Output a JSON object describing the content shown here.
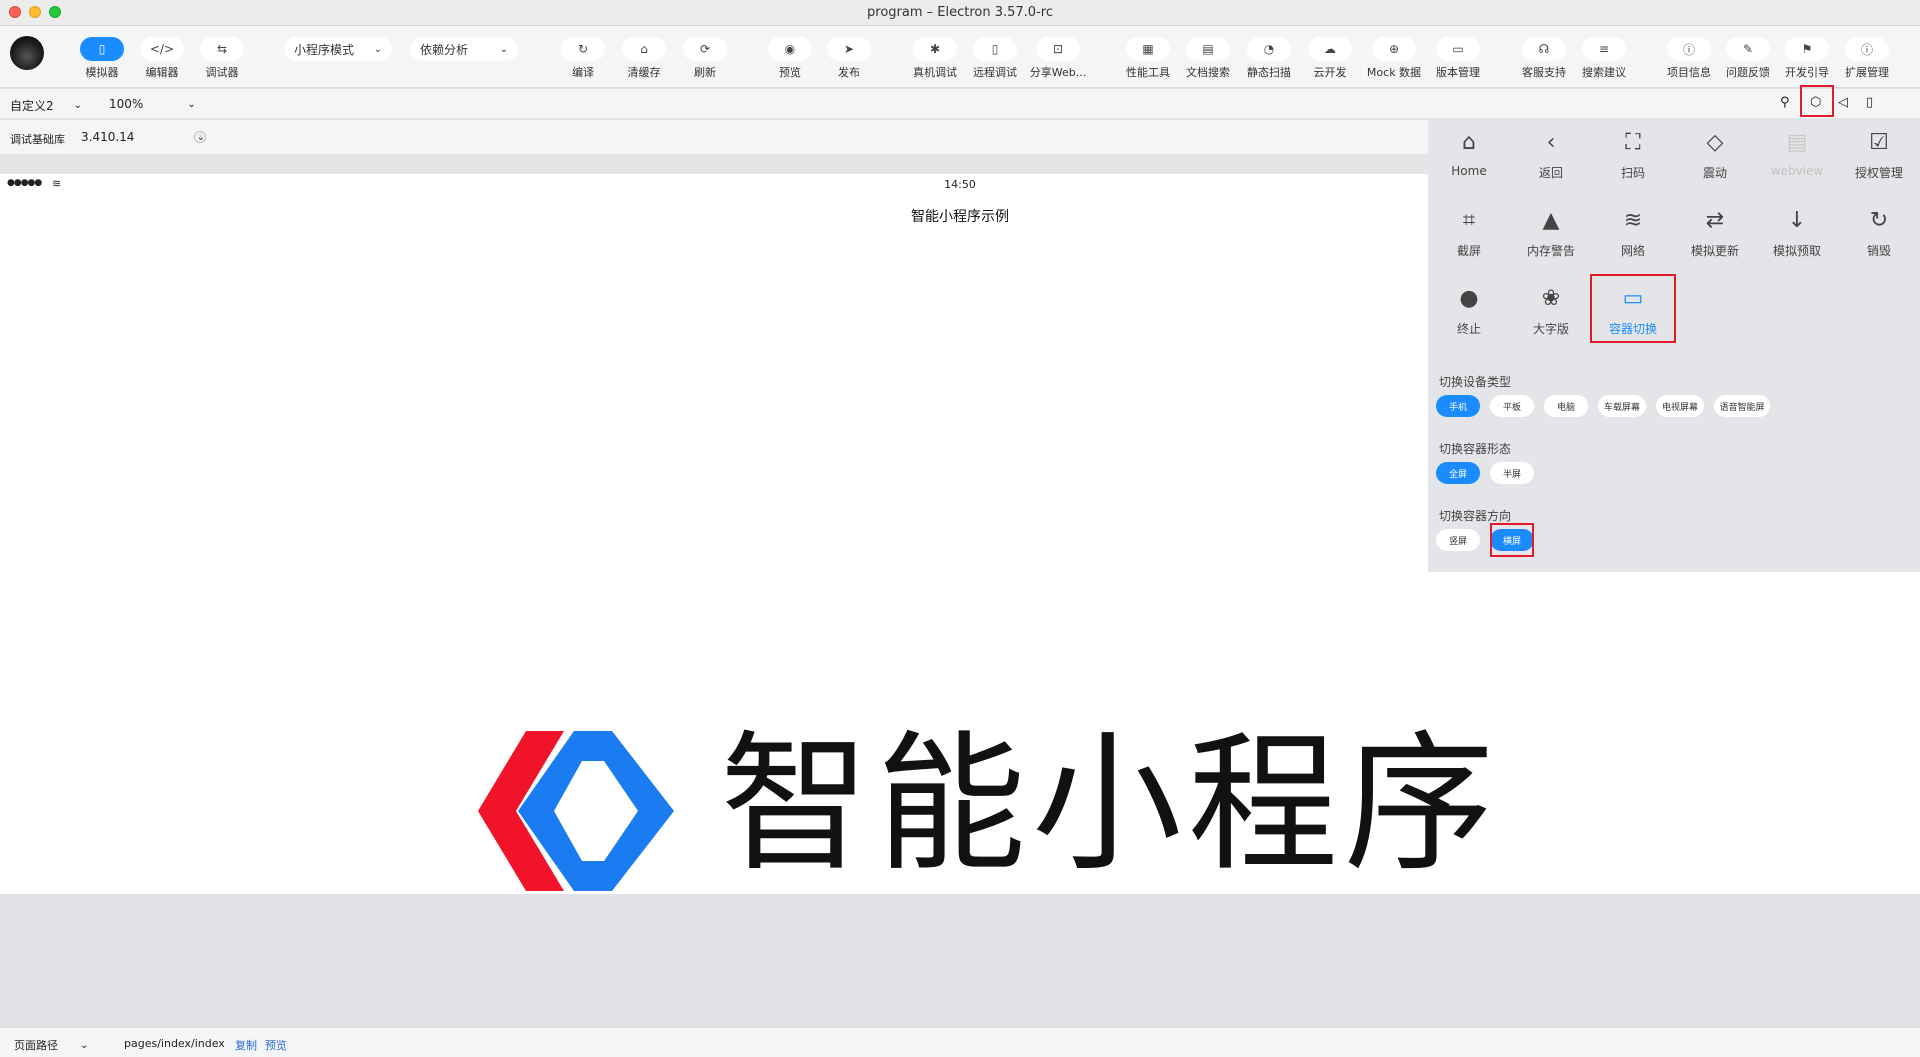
{
  "window": {
    "title": "program – Electron 3.57.0-rc"
  },
  "toolbar": {
    "left_buttons": [
      {
        "icon": "phone-icon",
        "glyph": "▯",
        "label": "模拟器",
        "active": true
      },
      {
        "icon": "code-icon",
        "glyph": "</>",
        "label": "编辑器",
        "active": false
      },
      {
        "icon": "sliders-icon",
        "glyph": "⇆",
        "label": "调试器",
        "active": false
      }
    ],
    "mode_select": "小程序模式",
    "analysis_select": "依赖分析",
    "center_buttons": [
      {
        "icon": "refresh-icon",
        "glyph": "↻",
        "label": "编译"
      },
      {
        "icon": "broom-icon",
        "glyph": "⌂",
        "label": "清缓存"
      },
      {
        "icon": "reload-icon",
        "glyph": "⟳",
        "label": "刷新"
      },
      {
        "icon": "eye-icon",
        "glyph": "◉",
        "label": "预览"
      },
      {
        "icon": "send-icon",
        "glyph": "➤",
        "label": "发布"
      },
      {
        "icon": "bug-icon",
        "glyph": "✱",
        "label": "真机调试"
      },
      {
        "icon": "mobile-icon",
        "glyph": "▯",
        "label": "远程调试"
      },
      {
        "icon": "share-icon",
        "glyph": "⊡",
        "label": "分享Web..."
      },
      {
        "icon": "gauge-icon",
        "glyph": "▦",
        "label": "性能工具"
      },
      {
        "icon": "doc-search-icon",
        "glyph": "▤",
        "label": "文档搜索"
      },
      {
        "icon": "scan-icon",
        "glyph": "◔",
        "label": "静态扫描"
      },
      {
        "icon": "cloud-icon",
        "glyph": "☁",
        "label": "云开发"
      },
      {
        "icon": "globe-icon",
        "glyph": "⊕",
        "label": "Mock 数据"
      },
      {
        "icon": "monitor-icon",
        "glyph": "▭",
        "label": "版本管理"
      }
    ],
    "right_buttons": [
      {
        "icon": "headset-icon",
        "glyph": "☊",
        "label": "客服支持"
      },
      {
        "icon": "search-suggest-icon",
        "glyph": "≡",
        "label": "搜索建议"
      },
      {
        "icon": "info-icon",
        "glyph": "ⓘ",
        "label": "项目信息"
      },
      {
        "icon": "pen-icon",
        "glyph": "✎",
        "label": "问题反馈"
      },
      {
        "icon": "flag-icon",
        "glyph": "⚑",
        "label": "开发引导"
      },
      {
        "icon": "extension-icon",
        "glyph": "ⓘ",
        "label": "扩展管理"
      }
    ]
  },
  "device_bar": {
    "device": "自定义2",
    "zoom": "100%",
    "icons": [
      "user-icon",
      "cube-icon",
      "speaker-icon",
      "copy-icon"
    ]
  },
  "debug_bar": {
    "label": "调试基础库",
    "version": "3.410.14"
  },
  "phone": {
    "signal": "●●●●●",
    "time": "14:50",
    "nav_title": "智能小程序示例",
    "logo_text": "智能小程序"
  },
  "panel": {
    "items": [
      {
        "icon": "home-icon",
        "glyph": "⌂",
        "label": "Home",
        "state": "normal"
      },
      {
        "icon": "back-icon",
        "glyph": "‹",
        "label": "返回",
        "state": "normal"
      },
      {
        "icon": "scan-frame-icon",
        "glyph": "⛶",
        "label": "扫码",
        "state": "normal"
      },
      {
        "icon": "vibrate-icon",
        "glyph": "◇",
        "label": "震动",
        "state": "normal"
      },
      {
        "icon": "webview-icon",
        "glyph": "▤",
        "label": "webview",
        "state": "disabled"
      },
      {
        "icon": "auth-icon",
        "glyph": "☑",
        "label": "授权管理",
        "state": "normal"
      },
      {
        "icon": "crop-icon",
        "glyph": "⌗",
        "label": "截屏",
        "state": "normal"
      },
      {
        "icon": "warning-icon",
        "glyph": "▲",
        "label": "内存警告",
        "state": "normal"
      },
      {
        "icon": "wifi-icon",
        "glyph": "≋",
        "label": "网络",
        "state": "normal"
      },
      {
        "icon": "repeat-icon",
        "glyph": "⇄",
        "label": "模拟更新",
        "state": "normal"
      },
      {
        "icon": "arrow-down-icon",
        "glyph": "↓",
        "label": "模拟预取",
        "state": "normal"
      },
      {
        "icon": "rotate-icon",
        "glyph": "↻",
        "label": "销毁",
        "state": "normal"
      },
      {
        "icon": "stop-icon",
        "glyph": "●",
        "label": "终止",
        "state": "normal"
      },
      {
        "icon": "paw-icon",
        "glyph": "❀",
        "label": "大字版",
        "state": "normal"
      },
      {
        "icon": "monitor-icon",
        "glyph": "▭",
        "label": "容器切换",
        "state": "selected"
      }
    ],
    "device_type": {
      "title": "切换设备类型",
      "options": [
        "手机",
        "平板",
        "电脑",
        "车载屏幕",
        "电视屏幕",
        "语音智能屏"
      ],
      "selected": 0
    },
    "container_form": {
      "title": "切换容器形态",
      "options": [
        "全屏",
        "半屏"
      ],
      "selected": 0
    },
    "container_direction": {
      "title": "切换容器方向",
      "options": [
        "竖屏",
        "横屏"
      ],
      "selected": 1
    }
  },
  "bottom_bar": {
    "path_label": "页面路径",
    "path": "pages/index/index",
    "copy": "复制",
    "preview": "预览"
  },
  "colors": {
    "accent": "#1a8cff",
    "highlight": "#e21b2b",
    "logo_red": "#f0132a",
    "logo_blue": "#1a7cf0"
  }
}
